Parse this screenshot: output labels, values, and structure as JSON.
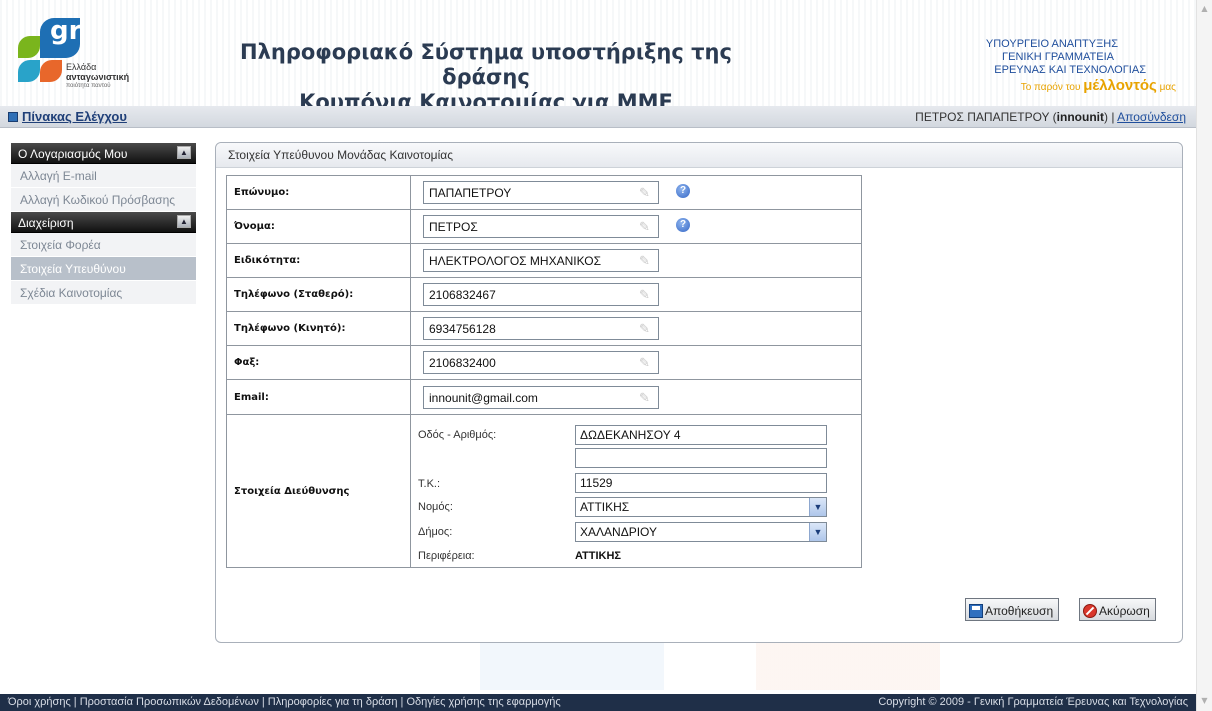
{
  "header": {
    "logo": {
      "mark": "gr",
      "line1": "Ελλάδα",
      "line2": "ανταγωνιστική",
      "line3": "ποιότητα παντού"
    },
    "title_line1": "Πληροφοριακό Σύστημα υποστήριξης της δράσης",
    "title_line2": "Κουπόνια Καινοτομίας για ΜΜΕ",
    "ministry_line1": "ΥΠΟΥΡΓΕΙΟ ΑΝΑΠΤΥΞΗΣ",
    "ministry_line2": "ΓΕΝΙΚΗ ΓΡΑΜΜΑΤΕΙΑ",
    "ministry_line3": "ΕΡΕΥΝΑΣ ΚΑΙ ΤΕΧΝΟΛΟΓΙΑΣ",
    "slogan_pre": "Το παρόν του ",
    "slogan_big": "μέλλοντός",
    "slogan_post": " μας"
  },
  "navbar": {
    "dashboard_label": "Πίνακας Ελέγχου",
    "user_name": "ΠΕΤΡΟΣ ΠΑΠΑΠΕΤΡΟΥ (",
    "user_login": "innounit",
    "user_close": ")",
    "separator": " | ",
    "logout_label": "Αποσύνδεση"
  },
  "sidebar": {
    "section1_title": "Ο Λογαριασμός Μου",
    "section1_items": [
      "Αλλαγή E-mail",
      "Αλλαγή Κωδικού Πρόσβασης"
    ],
    "section2_title": "Διαχείριση",
    "section2_items": [
      "Στοιχεία Φορέα",
      "Στοιχεία Υπευθύνου",
      "Σχέδια Καινοτομίας"
    ]
  },
  "panel": {
    "title": "Στοιχεία Υπεύθυνου Μονάδας Καινοτομίας",
    "fields": [
      {
        "label": "Επώνυμο:",
        "value": "ΠΑΠΑΠΕΤΡΟΥ"
      },
      {
        "label": "Όνομα:",
        "value": "ΠΕΤΡΟΣ"
      },
      {
        "label": "Ειδικότητα:",
        "value": "ΗΛΕΚΤΡΟΛΟΓΟΣ ΜΗΧΑΝΙΚΟΣ"
      },
      {
        "label": "Τηλέφωνο (Σταθερό):",
        "value": "2106832467"
      },
      {
        "label": "Τηλέφωνο (Κινητό):",
        "value": "6934756128"
      },
      {
        "label": "Φαξ:",
        "value": "2106832400"
      },
      {
        "label": "Email:",
        "value": "innounit@gmail.com"
      }
    ],
    "address": {
      "label": "Στοιχεία Διεύθυνσης",
      "street_label": "Οδός - Αριθμός:",
      "street_value": "ΔΩΔΕΚΑΝΗΣΟΥ 4",
      "street2_value": "",
      "zip_label": "Τ.Κ.:",
      "zip_value": "11529",
      "prefecture_label": "Νομός:",
      "prefecture_value": "ΑΤΤΙΚΗΣ",
      "municipality_label": "Δήμος:",
      "municipality_value": "ΧΑΛΑΝΔΡΙΟΥ",
      "region_label": "Περιφέρεια:",
      "region_value": "ΑΤΤΙΚΗΣ"
    },
    "save_label": "Αποθήκευση",
    "cancel_label": "Ακύρωση"
  },
  "footer": {
    "links": "Όροι χρήσης |  Προστασία Προσωπικών Δεδομένων |  Πληροφορίες για τη δράση |  Οδηγίες χρήσης της εφαρμογής",
    "copyright": "Copyright © 2009 - Γενική Γραμματεία Έρευνας και Τεχνολογίας"
  },
  "colors": {
    "title": "#2b3b52",
    "ministry": "#1f4e9c",
    "slogan": "#e8a300",
    "footer_bg": "#1f2f48",
    "sidebar_active": "#b8c0ca"
  },
  "icons": {
    "dashboard": "dashboard-icon",
    "help": "help-icon",
    "edit": "pencil-icon",
    "save": "save-icon",
    "cancel": "cancel-icon",
    "dropdown": "chevron-down-icon"
  }
}
